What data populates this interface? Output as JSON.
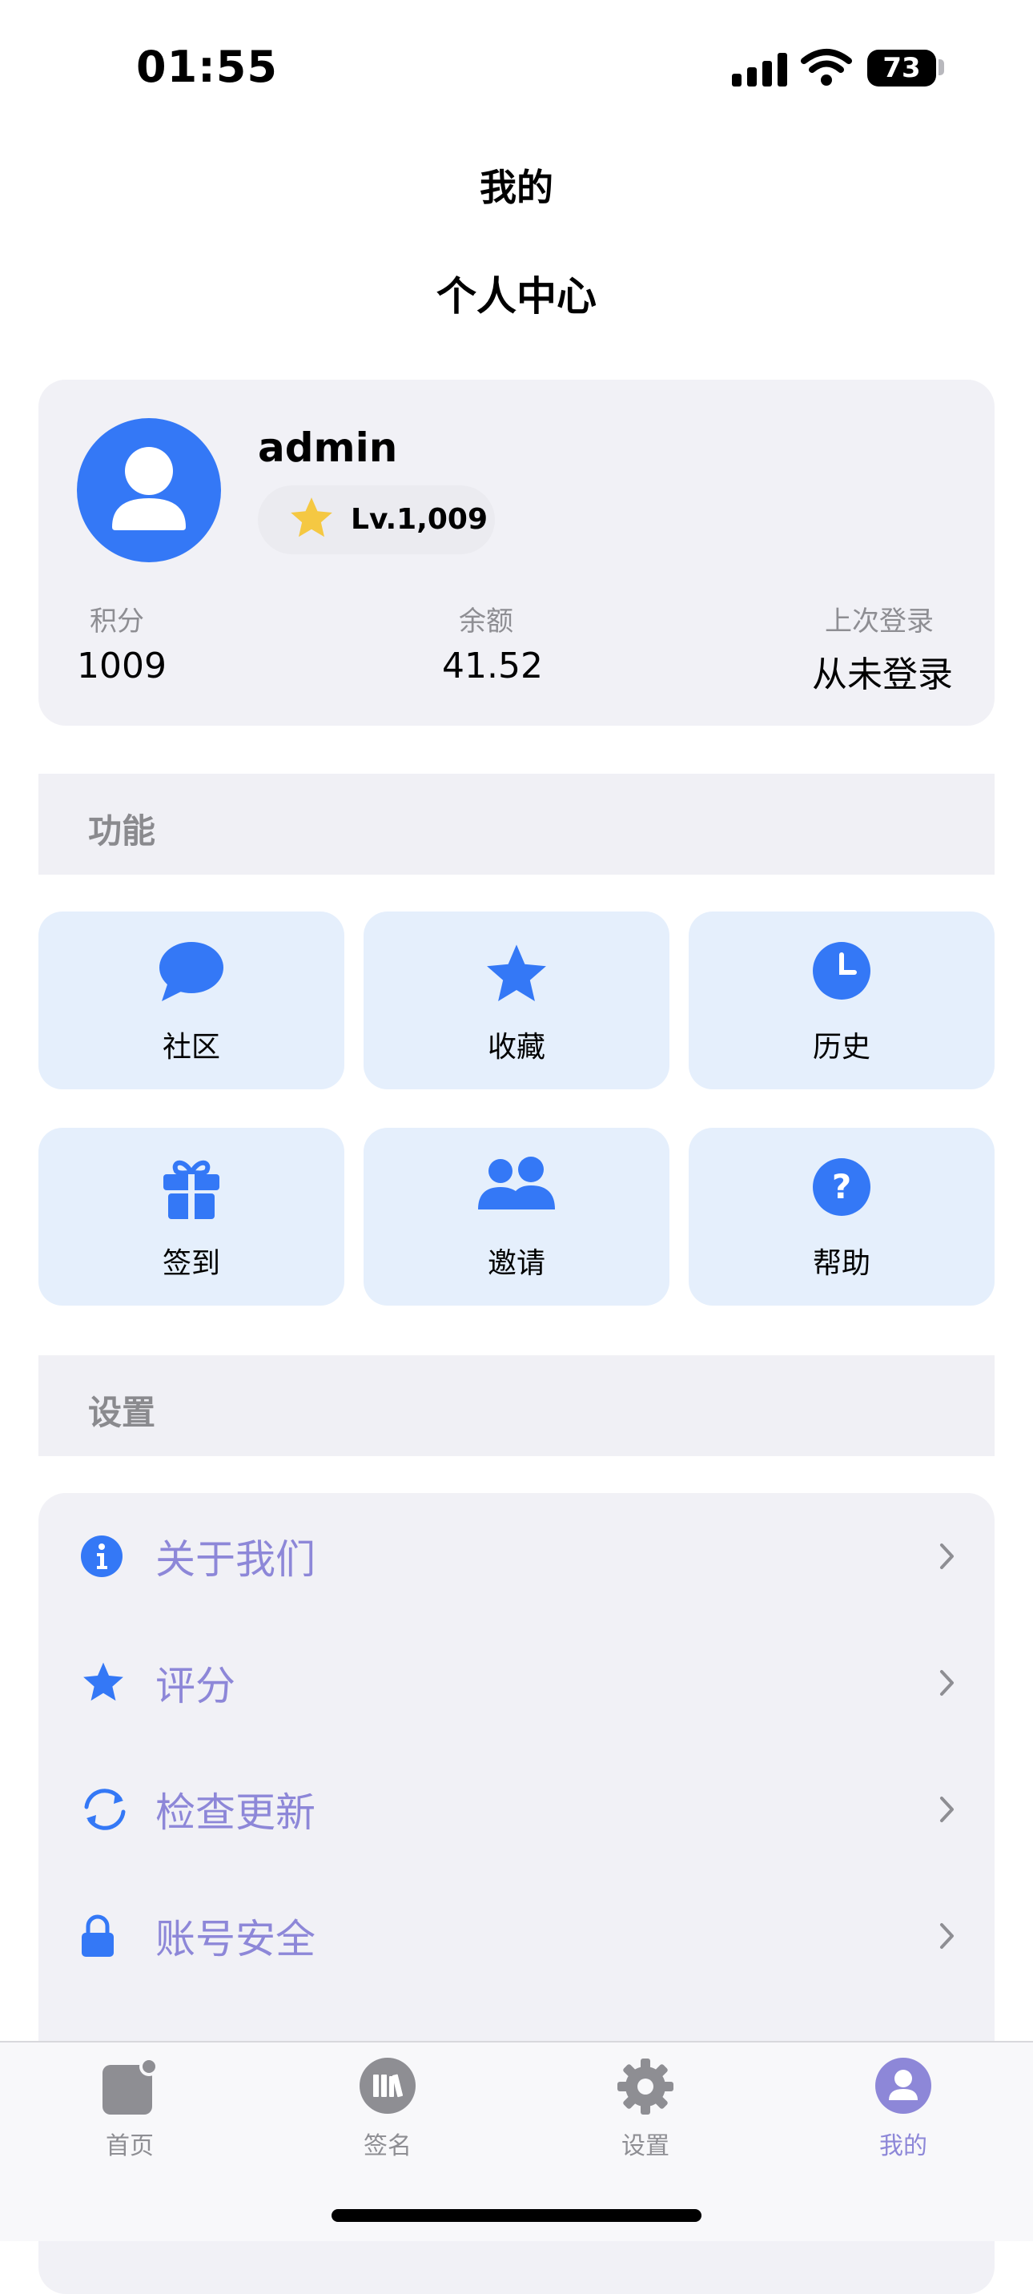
{
  "status_bar": {
    "time": "01:55",
    "battery": "73"
  },
  "nav": {
    "title": "我的"
  },
  "page": {
    "title": "个人中心"
  },
  "profile": {
    "username": "admin",
    "level": "Lv.1,009",
    "stats": [
      {
        "label": "积分",
        "value": "1009"
      },
      {
        "label": "余额",
        "value": "41.52"
      },
      {
        "label": "上次登录",
        "value": "从未登录"
      }
    ]
  },
  "features": {
    "header": "功能",
    "items": [
      {
        "label": "社区",
        "icon": "chat-bubble-icon"
      },
      {
        "label": "收藏",
        "icon": "star-icon"
      },
      {
        "label": "历史",
        "icon": "clock-icon"
      },
      {
        "label": "签到",
        "icon": "gift-icon"
      },
      {
        "label": "邀请",
        "icon": "people-icon"
      },
      {
        "label": "帮助",
        "icon": "question-icon"
      }
    ]
  },
  "settings": {
    "header": "设置",
    "items": [
      {
        "label": "关于我们",
        "icon": "info-icon"
      },
      {
        "label": "评分",
        "icon": "star-icon"
      },
      {
        "label": "检查更新",
        "icon": "refresh-icon"
      },
      {
        "label": "账号安全",
        "icon": "lock-icon"
      }
    ]
  },
  "tabbar": {
    "items": [
      {
        "label": "首页",
        "icon": "home-icon",
        "active": false
      },
      {
        "label": "签名",
        "icon": "books-icon",
        "active": false
      },
      {
        "label": "设置",
        "icon": "gear-icon",
        "active": false
      },
      {
        "label": "我的",
        "icon": "person-icon",
        "active": true
      }
    ]
  },
  "colors": {
    "accent": "#3478F6",
    "tile_bg": "#E5EFFC",
    "card_bg": "#F1F1F6",
    "settings_text": "#8D87D8",
    "tab_active": "#8D87D8",
    "tab_inactive": "#8E8E93",
    "star": "#F5C842"
  }
}
